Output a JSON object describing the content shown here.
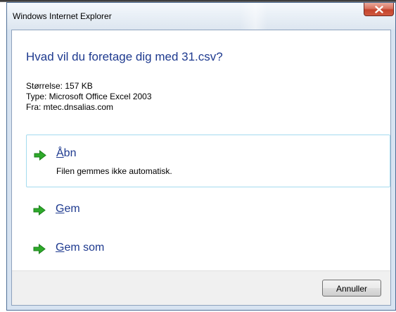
{
  "window": {
    "title": "Windows Internet Explorer"
  },
  "dialog": {
    "heading": "Hvad vil du foretage dig med 31.csv?",
    "size_line": "Størrelse: 157 KB",
    "type_line": "Type: Microsoft Office Excel 2003",
    "from_line": "Fra: mtec.dnsalias.com"
  },
  "options": {
    "open": {
      "label_accel": "Å",
      "label_rest": "bn",
      "description": "Filen gemmes ikke automatisk."
    },
    "save": {
      "label_accel": "G",
      "label_rest": "em"
    },
    "save_as": {
      "label_accel": "G",
      "label_rest": "em som"
    }
  },
  "footer": {
    "cancel_label": "Annuller"
  },
  "colors": {
    "heading_blue": "#1e3a8f",
    "arrow_green": "#2eaa2a",
    "highlight_border": "#a4dbef"
  },
  "icons": {
    "close": "close-icon",
    "option_arrow": "green-arrow-icon"
  }
}
